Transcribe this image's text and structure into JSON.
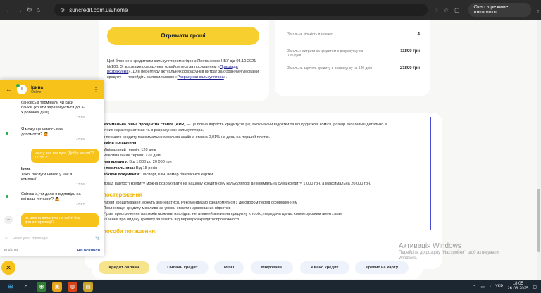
{
  "browser": {
    "url": "suncredit.com.ua/home",
    "incognito_label": "Окно в режиме инкогнито"
  },
  "card1": {
    "button": "Отримати гроші",
    "text_pre": "Цей блок не є кредитним калькулятором згідно з Постановою НБУ від 05.10.2021 №100. Зі зразками розрахунків ознайомтесь за посиланням «",
    "link1": "Приклади розрахунків",
    "text_mid": "». Для перегляду актуальних розрахунків витрат за обраними умовами кредиту — перейдіть за посиланням «",
    "link2": "Розрахунки калькулятора",
    "text_end": "»."
  },
  "card2": {
    "rows": [
      {
        "label": "Загальна кількість платежів:",
        "value": "4"
      },
      {
        "label": "Загальні витрати за кредитом в розрахунку на 120 днів",
        "value": "11800 грн"
      },
      {
        "label": "Загальна вартість кредиту в розрахунку на 120 днів",
        "value": "21800 грн"
      }
    ]
  },
  "info": {
    "apr_label": "аксимальна річна процентна ставка (APR)",
    "apr_text": " — це повна вартість кредиту за рік, включаючи відсотки та всі додаткові комісії, розмір якої більш детально в",
    "apr_text2": "отних характеристиках та в розрахунках калькулятора.",
    "first_credit": "я першого кредиту максимально можлива акційна ставка 0,01% на день на перший платіж.",
    "terms_label": "рміни погашення:",
    "min_term": "Мінімальний термін: 120 днів",
    "max_term": "Максимальний термін: 120 днів",
    "sum_label": "ума кредиту:",
    "sum_value": " Від 1 000 до 20 000 грн",
    "age_label": "к позичальника:",
    "age_value": " Від 18 років",
    "docs_label": "обхідні документи:",
    "docs_value": " Паспорт, ІПН, номер банківської картки",
    "example": "иклад вартості кредиту можна розрахувати на нашому кредитному калькуляторі де мінімальна сума кредиту 1 000 грн, а максимальна 20 000 грн.",
    "warning_heading": "постереження",
    "warnings": [
      "Умови кредитування можуть змінюватися. Рекомендуємо ознайомитися з договором перед оформленням",
      "Пролонгація кредиту можлива за умови сплати нарахованих відсотків",
      "У разі прострочення платежів можливі наслідки: негативний вплив на кредитну історію, передача даних колекторським агентствам",
      "Рішення про видачу кредиту залежить від перевірки кредитоспроможності"
    ],
    "repay_heading": "пособи погашення:"
  },
  "tabs": [
    "Кредит онлайн",
    "Онлайн кредит",
    "МФО",
    "Мікрозайм",
    "Аванс кредит",
    "Кредит на карту"
  ],
  "watermark": {
    "title": "Активація Windows",
    "line1": "Перейдіть до розділу \"Настройки\", щоб активувати",
    "line2": "Windows."
  },
  "chat": {
    "agent_name": "Ірина",
    "agent_status": "Online",
    "avatar_letter": "І",
    "m1": "банківські термінали чи каси банків (кошти зараховуються до 3-х робочих днів)",
    "t1": "17:55",
    "m2": "Я можу ще чимось вам допомогти? 🙋",
    "t2": "17:55",
    "me": "чи є у вас послуга \"Добір кошти\"?",
    "me_time": "17:55 ✓",
    "sender": "Ірина",
    "m3": "Такої послуги немає у нас в компанії.",
    "t3": "17:56",
    "m4": "Світлана, чи дала я відповідь на всі ваші питання? 🙇",
    "t4": "17:57",
    "me2": "як можна оплатити на сайті без доп.авторизації?",
    "input_placeholder": "Enter your message...",
    "end_chat": "End chat",
    "powered": "HELPCRUNCH"
  },
  "taskbar": {
    "lang": "УКР",
    "time": "18:05",
    "date": "26.08.2025"
  }
}
